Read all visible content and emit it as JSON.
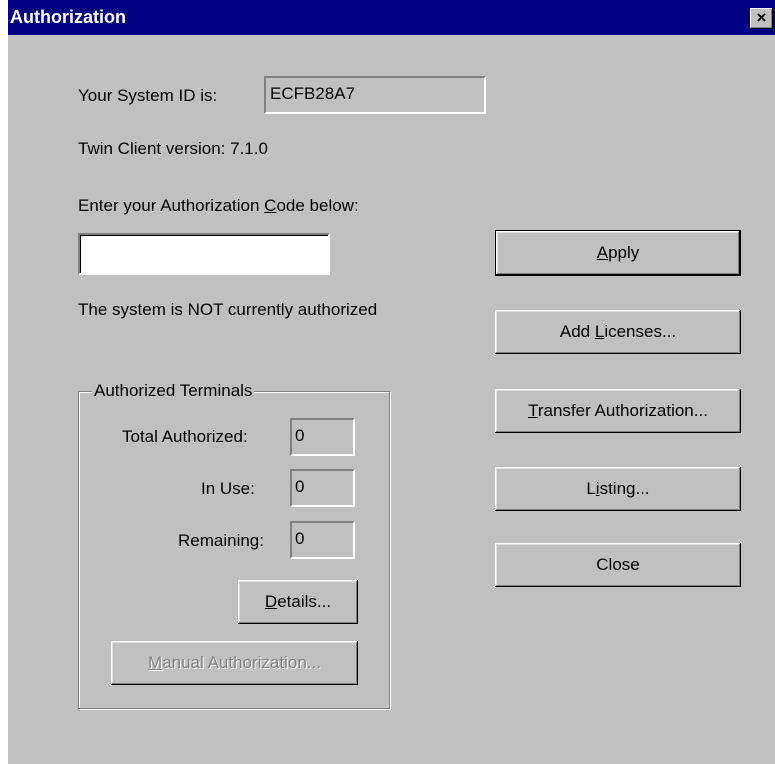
{
  "window": {
    "title": "Authorization",
    "close_label": "×"
  },
  "system_id": {
    "label": "Your System ID is:",
    "value": "ECFB28A7"
  },
  "version_text": "Twin Client version: 7.1.0",
  "auth_code": {
    "label_pre": "Enter your Authorization ",
    "label_key": "C",
    "label_post": "ode below:",
    "value": ""
  },
  "status_text": "The system is NOT currently authorized",
  "buttons": {
    "apply": {
      "key": "A",
      "rest": "pply"
    },
    "add_licenses": {
      "pre": "Add ",
      "key": "L",
      "rest": "icenses..."
    },
    "transfer": {
      "key": "T",
      "rest": "ransfer Authorization..."
    },
    "listing": {
      "key": "L",
      "key2": "i",
      "rest": "sting..."
    },
    "close": {
      "label": "Close"
    },
    "details": {
      "key": "D",
      "rest": "etails..."
    },
    "manual": {
      "key": "M",
      "rest": "anual Authorization..."
    }
  },
  "terminals": {
    "group_title": "Authorized Terminals",
    "total_label": "Total Authorized:",
    "total_value": "0",
    "in_use_label": "In Use:",
    "in_use_value": "0",
    "remaining_label": "Remaining:",
    "remaining_value": "0"
  }
}
